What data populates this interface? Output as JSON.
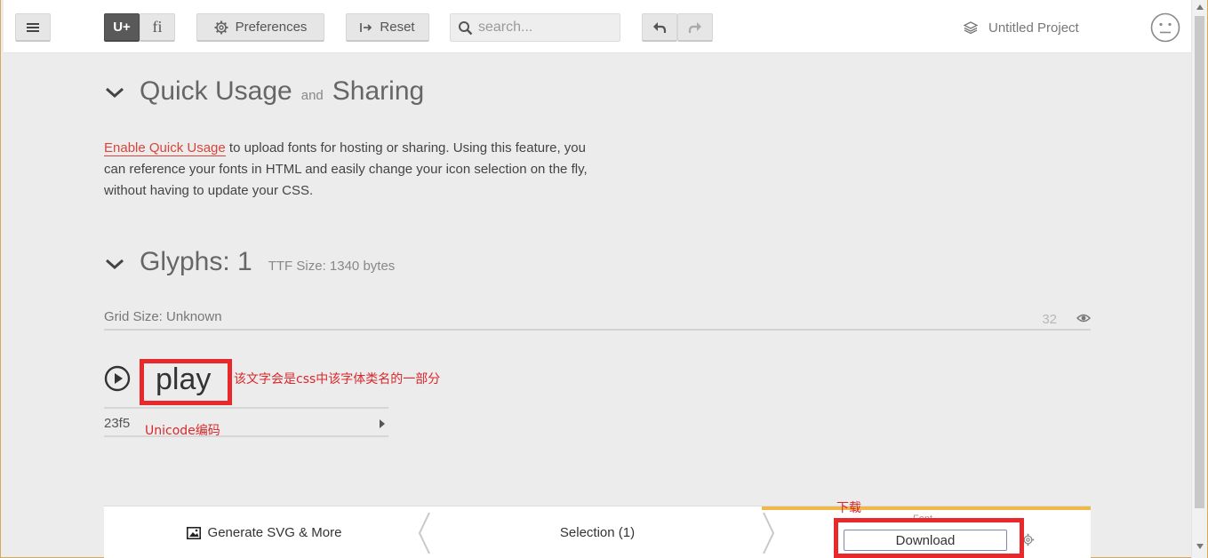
{
  "toolbar": {
    "unicode_label": "U+",
    "ligature_label": "fi",
    "preferences_label": "Preferences",
    "reset_label": "Reset",
    "search_placeholder": "search...",
    "project_name": "Untitled Project"
  },
  "quick_usage": {
    "title_main": "Quick Usage",
    "title_and": "and",
    "title_end": "Sharing",
    "link_text": "Enable Quick Usage",
    "description": " to upload fonts for hosting or sharing. Using this feature, you can reference your fonts in HTML and easily change your icon selection on the fly, without having to update your CSS."
  },
  "glyphs": {
    "title": "Glyphs: 1",
    "ttf_size": "TTF Size: 1340 bytes",
    "grid_size": "Grid Size: Unknown",
    "grid_value": "32",
    "glyph_name": "play",
    "glyph_code": "23f5"
  },
  "annotations": {
    "name_note": "该文字会是css中该字体类名的一部分",
    "code_note": "Unicode编码",
    "download_note": "下载"
  },
  "bottom_bar": {
    "generate_label": "Generate SVG & More",
    "selection_label": "Selection (1)",
    "font_label": "Font",
    "download_label": "Download"
  },
  "colors": {
    "link": "#d9443a",
    "annotation": "#e8282b",
    "font_tab_accent": "#f0b84a"
  }
}
